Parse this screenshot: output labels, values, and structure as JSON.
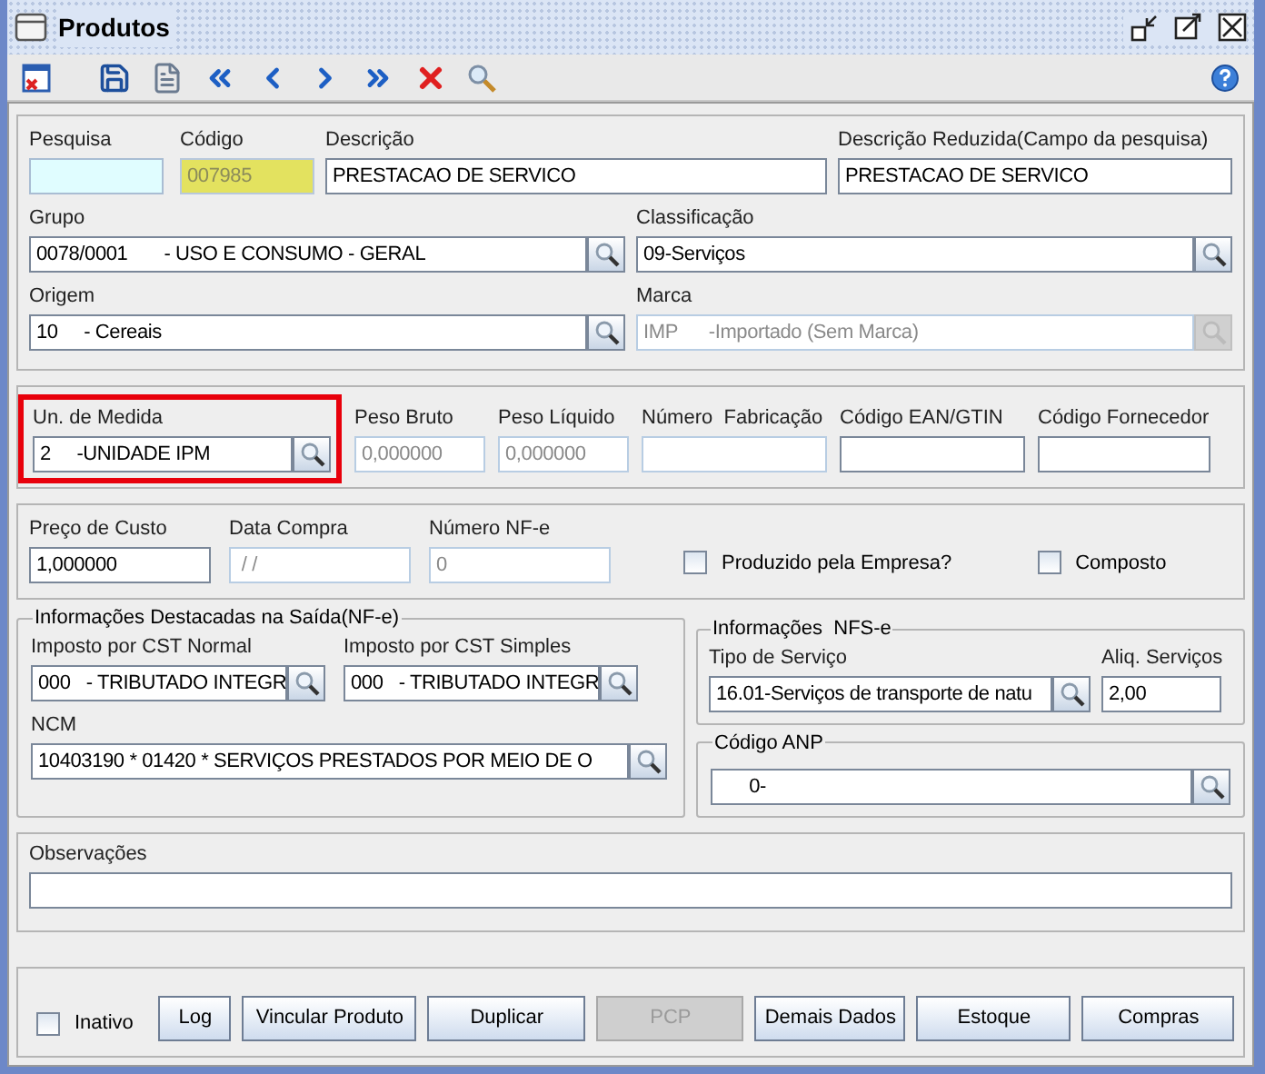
{
  "window": {
    "title": "Produtos"
  },
  "identification": {
    "fields": [
      {
        "label": "Pesquisa",
        "kind": "text",
        "focused": true,
        "readonly": false,
        "disabled": false
      },
      {
        "label": "Código",
        "value": "007985",
        "kind": "text",
        "focused": false,
        "readonly": true,
        "disabled": false
      },
      {
        "label": "Descrição",
        "value": "PRESTACAO DE SERVICO",
        "kind": "text",
        "focused": false,
        "readonly": false,
        "disabled": false
      },
      {
        "label": "Descrição Reduzida(Campo da pesquisa)",
        "value": "PRESTACAO DE SERVICO",
        "kind": "text",
        "focused": false,
        "readonly": false,
        "disabled": false
      },
      {
        "label": "Grupo",
        "value": "0078/0001       - USO E CONSUMO - GERAL",
        "kind": "lookup",
        "focused": false,
        "readonly": false,
        "disabled": false
      },
      {
        "label": "Classificação",
        "value": "09-Serviços",
        "kind": "lookup",
        "focused": false,
        "readonly": false,
        "disabled": false
      },
      {
        "label": "Origem",
        "value": "10     - Cereais",
        "kind": "lookup",
        "focused": false,
        "readonly": false,
        "disabled": false
      },
      {
        "label": "Marca",
        "value": "IMP      -Importado (Sem Marca)",
        "kind": "lookup",
        "focused": false,
        "readonly": false,
        "disabled": true
      }
    ]
  },
  "measures": {
    "fields": [
      {
        "label": "Un. de Medida",
        "value": "2     -UNIDADE IPM",
        "kind": "lookup",
        "disabled": false,
        "highlighted": true
      },
      {
        "label": "Peso Bruto",
        "value": "0,000000",
        "kind": "text",
        "disabled": true,
        "highlighted": false
      },
      {
        "label": "Peso Líquido",
        "value": "0,000000",
        "kind": "text",
        "disabled": true,
        "highlighted": false
      },
      {
        "label": "Número  Fabricação",
        "kind": "text",
        "disabled": true,
        "highlighted": false
      },
      {
        "label": "Código EAN/GTIN",
        "kind": "text",
        "disabled": false,
        "highlighted": false
      },
      {
        "label": "Código Fornecedor",
        "kind": "text",
        "disabled": false,
        "highlighted": false
      }
    ]
  },
  "purchase": {
    "fields": [
      {
        "label": "Preço de Custo",
        "value": "1,000000",
        "kind": "text",
        "disabled": false
      },
      {
        "label": "Data Compra",
        "value": " / /",
        "kind": "text",
        "disabled": true
      },
      {
        "label": "Número NF-e",
        "value": "0",
        "kind": "text",
        "disabled": true
      }
    ],
    "checkboxes": [
      {
        "label": "Produzido pela Empresa?",
        "checked": false
      },
      {
        "label": "Composto",
        "checked": false
      }
    ]
  },
  "nfe_group": {
    "title": "Informações Destacadas na Saída(NF-e)",
    "fields": [
      {
        "label": "Imposto por CST Normal",
        "value": "000   - TRIBUTADO INTEGR",
        "kind": "lookup",
        "disabled": false
      },
      {
        "label": "Imposto por CST Simples",
        "value": "000   - TRIBUTADO INTEGR",
        "kind": "lookup",
        "disabled": false
      },
      {
        "label": "NCM",
        "value": "10403190 * 01420 * SERVIÇOS PRESTADOS POR MEIO DE O",
        "kind": "lookup",
        "disabled": false
      }
    ]
  },
  "nfse_group": {
    "title": "Informações  NFS-e",
    "fields": [
      {
        "label": "Tipo de Serviço",
        "value": "16.01-Serviços de transporte de natu",
        "kind": "lookup",
        "disabled": false
      },
      {
        "label": "Aliq. Serviços",
        "value": "2,00",
        "kind": "text",
        "disabled": false
      }
    ]
  },
  "anp_group": {
    "title": "Código ANP",
    "fields": [
      {
        "value": "      0-",
        "kind": "lookup",
        "disabled": false
      }
    ]
  },
  "notes": {
    "fields": [
      {
        "label": "Observações",
        "kind": "text",
        "disabled": false
      }
    ]
  },
  "footer": {
    "checkbox": {
      "label": "Inativo",
      "checked": false
    },
    "buttons": [
      {
        "label": "Log",
        "disabled": false
      },
      {
        "label": "Vincular Produto",
        "disabled": false
      },
      {
        "label": "Duplicar",
        "disabled": false
      },
      {
        "label": "PCP",
        "disabled": true
      },
      {
        "label": "Demais Dados",
        "disabled": false
      },
      {
        "label": "Estoque",
        "disabled": false
      },
      {
        "label": "Compras",
        "disabled": false
      }
    ]
  }
}
